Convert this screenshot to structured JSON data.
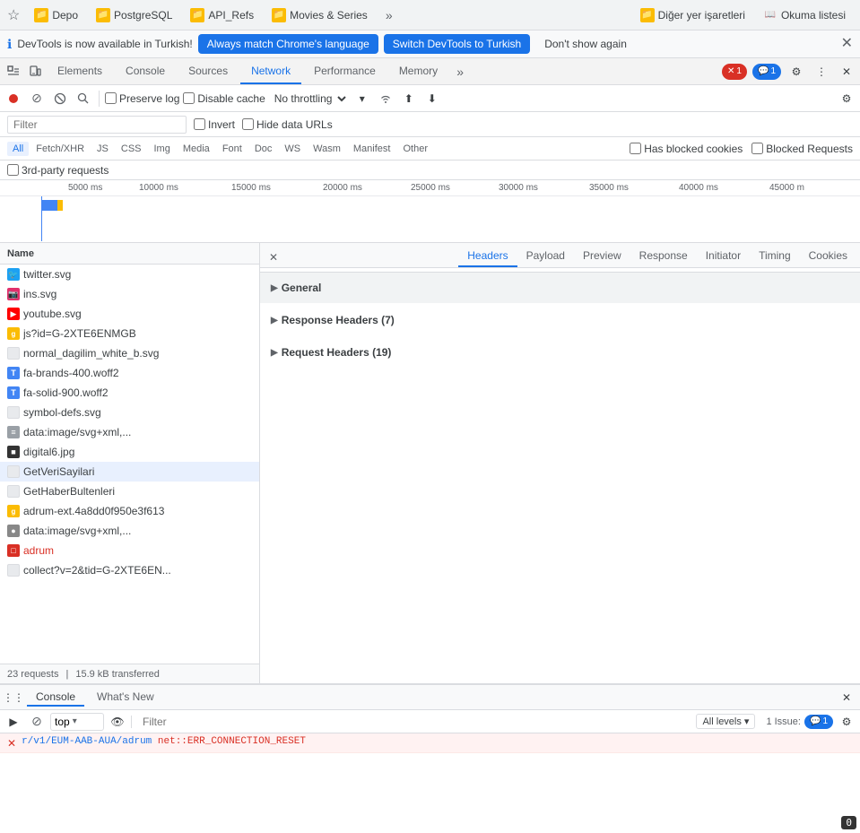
{
  "browser": {
    "bookmarks": [
      {
        "label": "Depo",
        "color": "#fbbc04",
        "icon": "📁"
      },
      {
        "label": "PostgreSQL",
        "color": "#fbbc04",
        "icon": "📁"
      },
      {
        "label": "API_Refs",
        "color": "#fbbc04",
        "icon": "📁"
      },
      {
        "label": "Movies & Series",
        "color": "#fbbc04",
        "icon": "📁"
      },
      {
        "label": "Diğer yer işaretleri",
        "color": "#fbbc04",
        "icon": "📁"
      },
      {
        "label": "Okuma listesi",
        "color": "#fbbc04",
        "icon": "📖"
      }
    ]
  },
  "notification": {
    "text": "DevTools is now available in Turkish!",
    "btn1": "Always match Chrome's language",
    "btn2": "Switch DevTools to Turkish",
    "btn3": "Don't show again",
    "close": "✕"
  },
  "devtools": {
    "tabs": [
      {
        "label": "Elements",
        "active": false
      },
      {
        "label": "Console",
        "active": false
      },
      {
        "label": "Sources",
        "active": false
      },
      {
        "label": "Network",
        "active": true
      },
      {
        "label": "Performance",
        "active": false
      },
      {
        "label": "Memory",
        "active": false
      }
    ],
    "more_tabs": "»",
    "error_badge": "1",
    "message_badge": "1",
    "close_icon": "✕"
  },
  "network_toolbar": {
    "record_title": "Record",
    "stop_title": "Stop",
    "clear_title": "Clear",
    "search_title": "Search",
    "preserve_log": "Preserve log",
    "disable_cache": "Disable cache",
    "throttle": "No throttling",
    "import_icon": "⬆",
    "export_icon": "⬇",
    "settings_icon": "⚙"
  },
  "filter_bar": {
    "placeholder": "Filter",
    "invert_label": "Invert",
    "hide_data_urls_label": "Hide data URLs",
    "types": [
      "All",
      "Fetch/XHR",
      "JS",
      "CSS",
      "Img",
      "Media",
      "Font",
      "Doc",
      "WS",
      "Wasm",
      "Manifest",
      "Other"
    ],
    "active_type": "All",
    "has_blocked_cookies": "Has blocked cookies",
    "blocked_requests": "Blocked Requests",
    "third_party": "3rd-party requests"
  },
  "timeline": {
    "ticks": [
      "5000 ms",
      "10000 ms",
      "15000 ms",
      "20000 ms",
      "25000 ms",
      "30000 ms",
      "35000 ms",
      "40000 ms",
      "45000 m"
    ]
  },
  "file_list": {
    "header": "Name",
    "files": [
      {
        "name": "twitter.svg",
        "icon": "🐦",
        "icon_bg": "#1da1f2",
        "selected": false,
        "error": false
      },
      {
        "name": "ins.svg",
        "icon": "📷",
        "icon_bg": "#e1306c",
        "selected": false,
        "error": false
      },
      {
        "name": "youtube.svg",
        "icon": "▶",
        "icon_bg": "#ff0000",
        "selected": false,
        "error": false
      },
      {
        "name": "js?id=G-2XTE6ENMGB",
        "icon": "g",
        "icon_bg": "#fbbc04",
        "selected": false,
        "error": false
      },
      {
        "name": "normal_dagilim_white_b.svg",
        "icon": "□",
        "icon_bg": "#fff",
        "selected": false,
        "error": false
      },
      {
        "name": "fa-brands-400.woff2",
        "icon": "T",
        "icon_bg": "#4285f4",
        "selected": false,
        "error": false
      },
      {
        "name": "fa-solid-900.woff2",
        "icon": "T",
        "icon_bg": "#4285f4",
        "selected": false,
        "error": false
      },
      {
        "name": "symbol-defs.svg",
        "icon": "□",
        "icon_bg": "#fff",
        "selected": false,
        "error": false
      },
      {
        "name": "data:image/svg+xml,...",
        "icon": "≡",
        "icon_bg": "#e8eaed",
        "selected": false,
        "error": false
      },
      {
        "name": "digital6.jpg",
        "icon": "■",
        "icon_bg": "#333",
        "selected": false,
        "error": false
      },
      {
        "name": "GetVeriSayilari",
        "icon": "□",
        "icon_bg": "#fff",
        "selected": true,
        "error": false
      },
      {
        "name": "GetHaberBultenleri",
        "icon": "□",
        "icon_bg": "#fff",
        "selected": false,
        "error": false
      },
      {
        "name": "adrum-ext.4a8dd0f950e3f613",
        "icon": "g",
        "icon_bg": "#fbbc04",
        "selected": false,
        "error": false
      },
      {
        "name": "data:image/svg+xml,...",
        "icon": "●",
        "icon_bg": "#888",
        "selected": false,
        "error": false
      },
      {
        "name": "adrum",
        "icon": "□",
        "icon_bg": "#d93025",
        "selected": false,
        "error": true
      },
      {
        "name": "collect?v=2&tid=G-2XTE6EN...",
        "icon": "□",
        "icon_bg": "#fff",
        "selected": false,
        "error": false
      }
    ],
    "footer": {
      "requests": "23 requests",
      "transferred": "15.9 kB transferred"
    }
  },
  "detail_panel": {
    "close_label": "✕",
    "tabs": [
      "Headers",
      "Payload",
      "Preview",
      "Response",
      "Initiator",
      "Timing",
      "Cookies"
    ],
    "active_tab": "Headers",
    "sections": [
      {
        "label": "General",
        "expanded": true
      },
      {
        "label": "Response Headers (7)",
        "expanded": false
      },
      {
        "label": "Request Headers (19)",
        "expanded": false
      }
    ]
  },
  "console": {
    "tabs": [
      "Console",
      "What's New"
    ],
    "active_tab": "Console",
    "context": "top",
    "filter_placeholder": "Filter",
    "all_levels_label": "All levels ▾",
    "issue_label": "1 Issue:",
    "issue_count": "1",
    "error_line": {
      "url": "r/v1/EUM-AAB-AUA/adrum",
      "error": "net::ERR_CONNECTION_RESET"
    },
    "counter_badge": "0"
  }
}
